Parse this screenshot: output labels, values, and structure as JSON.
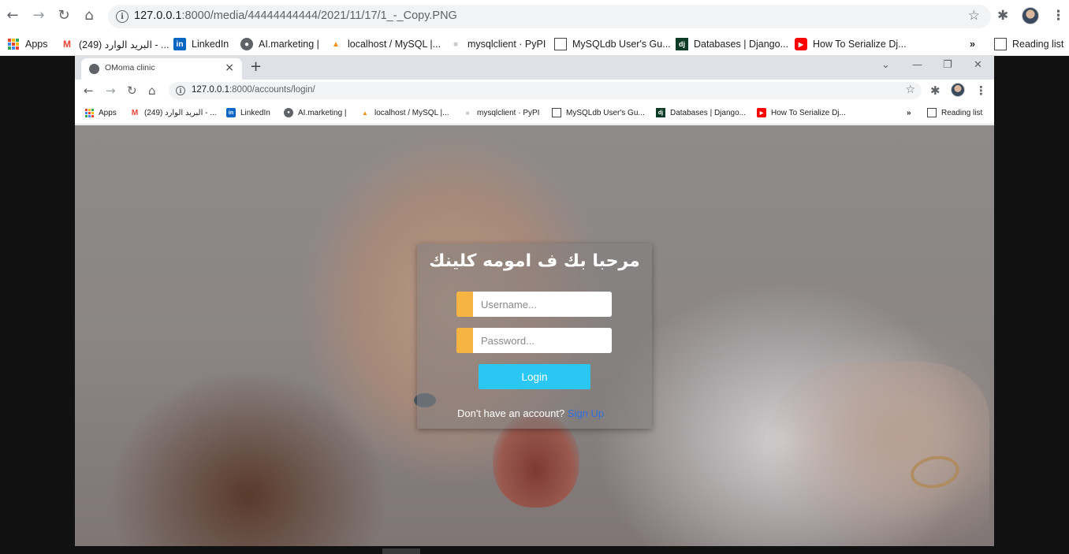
{
  "outer_browser": {
    "url_host": "127.0.0.1",
    "url_rest": ":8000/media/44444444444/2021/11/17/1_-_Copy.PNG",
    "bookmarks": [
      {
        "label": "Apps",
        "icon": "apps-grid-icon"
      },
      {
        "label": "(249) البريد الوارد - ...",
        "icon": "gmail-icon"
      },
      {
        "label": "LinkedIn",
        "icon": "linkedin-icon"
      },
      {
        "label": "AI.marketing |",
        "icon": "globe-icon"
      },
      {
        "label": "localhost / MySQL |...",
        "icon": "phpmyadmin-icon"
      },
      {
        "label": "mysqlclient · PyPI",
        "icon": "pypi-icon"
      },
      {
        "label": "MySQLdb User's Gu...",
        "icon": "doc-icon"
      },
      {
        "label": "Databases | Django...",
        "icon": "django-icon"
      },
      {
        "label": "How To Serialize Dj...",
        "icon": "youtube-icon"
      }
    ],
    "overflow_label": "»",
    "reading_list_label": "Reading list"
  },
  "inner_browser": {
    "tab_title": "OMoma clinic",
    "url_host": "127.0.0.1",
    "url_rest": ":8000/accounts/login/",
    "bookmarks": [
      {
        "label": "Apps",
        "icon": "apps-grid-icon"
      },
      {
        "label": "(249) البريد الوارد - ...",
        "icon": "gmail-icon"
      },
      {
        "label": "LinkedIn",
        "icon": "linkedin-icon"
      },
      {
        "label": "AI.marketing |",
        "icon": "globe-icon"
      },
      {
        "label": "localhost / MySQL |...",
        "icon": "phpmyadmin-icon"
      },
      {
        "label": "mysqlclient · PyPI",
        "icon": "pypi-icon"
      },
      {
        "label": "MySQLdb User's Gu...",
        "icon": "doc-icon"
      },
      {
        "label": "Databases | Django...",
        "icon": "django-icon"
      },
      {
        "label": "How To Serialize Dj...",
        "icon": "youtube-icon"
      }
    ],
    "overflow_label": "»",
    "reading_list_label": "Reading list"
  },
  "login": {
    "title": "مرحبا بك ف امومه كلينك",
    "username_placeholder": "Username...",
    "password_placeholder": "Password...",
    "button_label": "Login",
    "signup_prompt": "Don't have an account?",
    "signup_link": "Sign Up"
  },
  "colors": {
    "accent_orange": "#f6b443",
    "login_button": "#29c7f2",
    "signup_link": "#2f6fde"
  }
}
